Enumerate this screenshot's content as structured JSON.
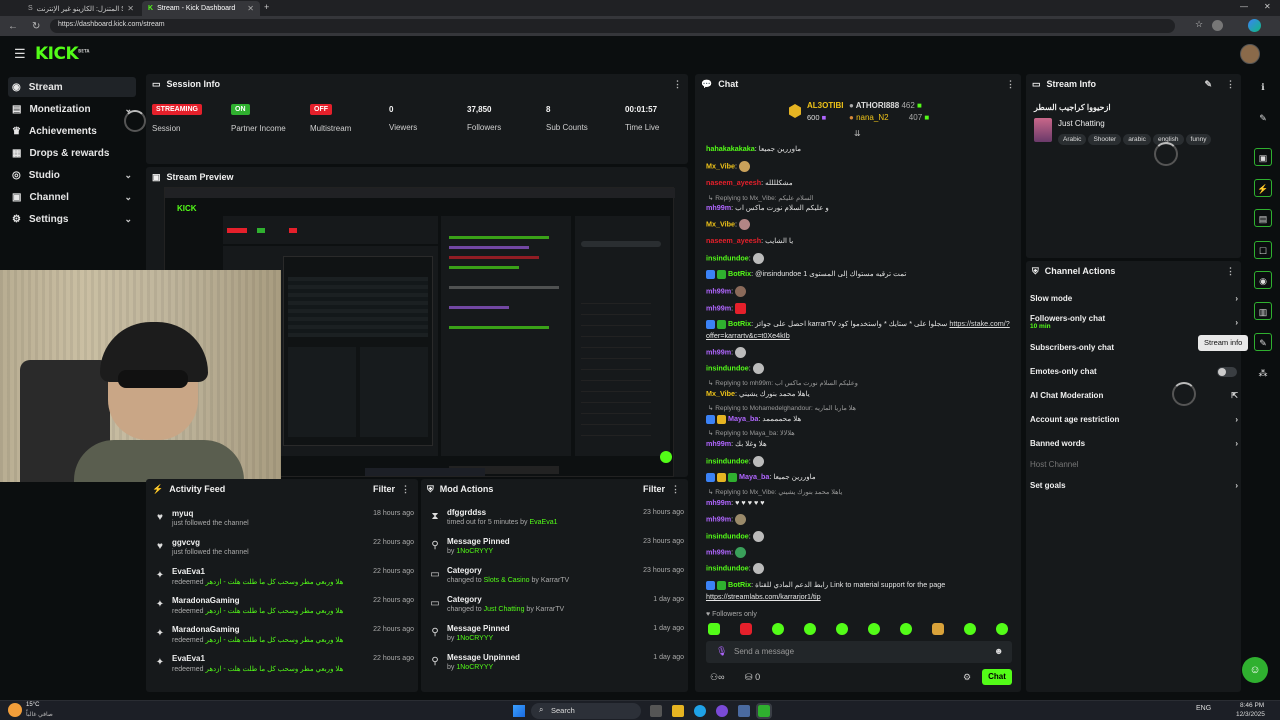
{
  "browser": {
    "tabs": [
      {
        "label": "المتنزل: الكازينو غير الإنترنت Stake",
        "active": false
      },
      {
        "label": "Stream - Kick Dashboard",
        "active": true
      }
    ],
    "url": "https://dashboard.kick.com/stream"
  },
  "brand": {
    "logo": "KICK",
    "logo_sup": "BETA",
    "accent": "#53fc18"
  },
  "sidebar": {
    "items": [
      {
        "label": "Stream",
        "icon": "broadcast-icon",
        "active": true,
        "chevron": false
      },
      {
        "label": "Monetization",
        "icon": "money-icon",
        "chevron": true
      },
      {
        "label": "Achievements",
        "icon": "trophy-icon",
        "chevron": false
      },
      {
        "label": "Drops & rewards",
        "icon": "gift-icon",
        "chevron": false
      },
      {
        "label": "Studio",
        "icon": "studio-icon",
        "chevron": true
      },
      {
        "label": "Channel",
        "icon": "channel-icon",
        "chevron": true
      },
      {
        "label": "Settings",
        "icon": "gear-icon",
        "chevron": true
      }
    ]
  },
  "session": {
    "title": "Session Info",
    "stats": [
      {
        "badge": "STREAMING",
        "badge_color": "#e5202b",
        "label": "Session"
      },
      {
        "badge": "ON",
        "badge_color": "#2fb02f",
        "label": "Partner Income"
      },
      {
        "badge": "OFF",
        "badge_color": "#e5202b",
        "label": "Multistream"
      },
      {
        "value": "0",
        "label": "Viewers"
      },
      {
        "value": "37,850",
        "label": "Followers"
      },
      {
        "value": "8",
        "label": "Sub Counts"
      },
      {
        "value": "00:01:57",
        "label": "Time Live"
      }
    ]
  },
  "preview": {
    "title": "Stream Preview"
  },
  "activity": {
    "title": "Activity Feed",
    "filter": "Filter",
    "items": [
      {
        "icon": "heart-icon",
        "name": "myuq",
        "detail": "just followed the channel",
        "time": "18 hours ago"
      },
      {
        "icon": "heart-icon",
        "name": "ggvcvg",
        "detail": "just followed the channel",
        "time": "22 hours ago"
      },
      {
        "icon": "reward-icon",
        "name": "EvaEva1",
        "detail": "redeemed",
        "reward": "هلا وربعي مطر وسحب كل ما طلت هلت - ازدهر",
        "time": "22 hours ago"
      },
      {
        "icon": "reward-icon",
        "name": "MaradonaGaming",
        "detail": "redeemed",
        "reward": "هلا وربعي مطر وسحب كل ما طلت هلت - ازدهر",
        "time": "22 hours ago"
      },
      {
        "icon": "reward-icon",
        "name": "MaradonaGaming",
        "detail": "redeemed",
        "reward": "هلا وربعي مطر وسحب كل ما طلت هلت - ازدهر",
        "time": "22 hours ago"
      },
      {
        "icon": "reward-icon",
        "name": "EvaEva1",
        "detail": "redeemed",
        "reward": "هلا وربعي مطر وسحب كل ما طلت هلت - ازدهر",
        "time": "22 hours ago"
      }
    ]
  },
  "mod": {
    "title": "Mod Actions",
    "filter": "Filter",
    "items": [
      {
        "icon": "hourglass-icon",
        "title": "dfggrddss",
        "pre": "timed out for 5 minutes by",
        "who": "EvaEva1",
        "time": "23 hours ago"
      },
      {
        "icon": "pin-icon",
        "title": "Message Pinned",
        "pre": "by",
        "who": "1NoCRYYY",
        "time": "23 hours ago"
      },
      {
        "icon": "category-icon",
        "title": "Category",
        "pre": "changed to",
        "who": "Slots & Casino",
        "by": "by KarrarTV",
        "time": "23 hours ago"
      },
      {
        "icon": "category-icon",
        "title": "Category",
        "pre": "changed to",
        "who": "Just Chatting",
        "by": "by KarrarTV",
        "time": "1 day ago"
      },
      {
        "icon": "pin-icon",
        "title": "Message Pinned",
        "pre": "by",
        "who": "1NoCRYYY",
        "time": "1 day ago"
      },
      {
        "icon": "unpin-icon",
        "title": "Message Unpinned",
        "pre": "by",
        "who": "1NoCRYYY",
        "time": "1 day ago"
      }
    ]
  },
  "chat": {
    "title": "Chat",
    "leaders": [
      {
        "name": "AL3OTIBI",
        "value": "600"
      },
      {
        "name": "ATHORI888",
        "value": "462"
      },
      {
        "name": "nana_N2",
        "value": "407"
      }
    ],
    "messages": [
      {
        "user": "hahakakakaka",
        "color": "#53fc18",
        "text": "ماوررين جميعا"
      },
      {
        "user": "Mx_Vibe",
        "color": "#f0c419",
        "text": "",
        "emote": true
      },
      {
        "user": "naseem_ayeesh",
        "color": "#e5202b",
        "text": "مشكلللله"
      },
      {
        "reply": "Replying to Mx_Vibe: السلام عليكم"
      },
      {
        "user": "mh99m",
        "color": "#b066ff",
        "text": "و عليكم السلام نورت ماكس اب"
      },
      {
        "user": "Mx_Vibe",
        "color": "#f0c419",
        "text": "",
        "emote": true
      },
      {
        "user": "naseem_ayeesh",
        "color": "#e5202b",
        "text": "يا الشايب"
      },
      {
        "user": "insindundoe",
        "color": "#53fc18",
        "text": "",
        "emote": true
      },
      {
        "user": "BotRix",
        "color": "#53fc18",
        "text": "@insindundoe 1 تمت ترقيه مستواك إلى المستوى",
        "badges": true
      },
      {
        "user": "mh99m",
        "color": "#b066ff",
        "text": "",
        "emote": true
      },
      {
        "user": "mh99m",
        "color": "#b066ff",
        "text": "",
        "emote": true
      },
      {
        "user": "BotRix",
        "color": "#53fc18",
        "text": "احصل على جوائز karrarTV سجلوا على * ستايك * واستخدموا كود",
        "link": "https://stake.com/?",
        "badges": true
      },
      {
        "link2": "offer=karrartv&c=t0Xe4kIb"
      },
      {
        "user": "mh99m",
        "color": "#b066ff",
        "text": "",
        "emote": true
      },
      {
        "user": "insindundoe",
        "color": "#53fc18",
        "text": "",
        "emote": true
      },
      {
        "reply": "Replying to mh99m: وعليكم السلام نورت ماكس اب"
      },
      {
        "user": "Mx_Vibe",
        "color": "#f0c419",
        "text": "ياهلا محمد بنورك يشيني"
      },
      {
        "reply": "Replying to Mohamedelghandour: هلا ماريا الماريه"
      },
      {
        "user": "Maya_ba",
        "color": "#b066ff",
        "text": "هلا محممممد",
        "badges": true
      },
      {
        "reply": "Replying to Maya_ba: هلالالا"
      },
      {
        "user": "mh99m",
        "color": "#b066ff",
        "text": "هلا وغلا بك"
      },
      {
        "user": "insindundoe",
        "color": "#53fc18",
        "text": "",
        "emote": true
      },
      {
        "user": "Maya_ba",
        "color": "#b066ff",
        "text": "ماوررين جميعا",
        "badges": true
      },
      {
        "reply": "Replying to Mx_Vibe: ياهلا محمد بنورك يشيني"
      },
      {
        "user": "mh99m",
        "color": "#b066ff",
        "text": "♥ ♥ ♥ ♥ ♥"
      },
      {
        "user": "mh99m",
        "color": "#b066ff",
        "text": "",
        "emote": true
      },
      {
        "user": "insindundoe",
        "color": "#53fc18",
        "text": "",
        "emote": true
      },
      {
        "user": "mh99m",
        "color": "#b066ff",
        "text": "",
        "emote": true
      },
      {
        "user": "insindundoe",
        "color": "#53fc18",
        "text": "",
        "emote": true
      },
      {
        "user": "BotRix",
        "color": "#53fc18",
        "text": "رابط الدعم المادي للقناة Link to material support for the page",
        "badges": true
      },
      {
        "link2": "https://streamlabs.com/karrarjor1/tip"
      }
    ],
    "followers_only": "Followers only",
    "input_placeholder": "Send a message",
    "points": "0",
    "send": "Chat"
  },
  "stream_info": {
    "title": "Stream Info",
    "stream_title": "ازحيووا كراجيب السطر",
    "category": "Just Chatting",
    "tags": [
      "Arabic",
      "Shooter",
      "arabic",
      "english",
      "funny"
    ]
  },
  "channel_actions": {
    "title": "Channel Actions",
    "items": [
      {
        "label": "Slow mode",
        "kind": "arrow"
      },
      {
        "label": "Followers-only chat",
        "sub": "10 min",
        "kind": "arrow"
      },
      {
        "label": "Subscribers-only chat",
        "kind": "toggle"
      },
      {
        "label": "Emotes-only chat",
        "kind": "toggle"
      },
      {
        "label": "AI Chat Moderation",
        "kind": "external"
      },
      {
        "label": "Account age restriction",
        "kind": "arrow"
      },
      {
        "label": "Banned words",
        "kind": "arrow"
      },
      {
        "label": "Host Channel",
        "kind": "disabled"
      },
      {
        "label": "Set goals",
        "kind": "arrow"
      }
    ],
    "tooltip": "Stream info"
  },
  "taskbar": {
    "weather_temp": "15°C",
    "weather_desc": "صافي غالباً",
    "search": "Search",
    "lang": "ENG",
    "time": "8:46 PM",
    "date": "12/3/2025"
  }
}
